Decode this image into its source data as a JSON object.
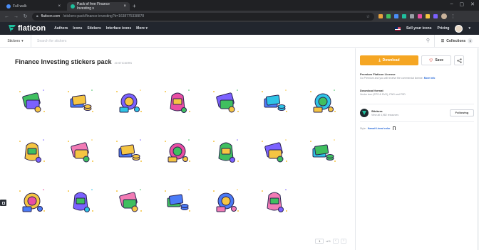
{
  "browser": {
    "tabs": [
      {
        "label": "Full walk",
        "active": false
      },
      {
        "label": "Pack of free Finance Investing s",
        "active": true
      }
    ],
    "new_tab": "+",
    "url_domain": "flaticon.com",
    "url_path": "/stickers-pack/finance-investing?k=1638775338878",
    "window_controls": [
      "–",
      "▢",
      "✕"
    ]
  },
  "site": {
    "logo": "flaticon",
    "nav": [
      "Authors",
      "Icons",
      "Stickers",
      "Interface icons",
      "More ▾"
    ],
    "right": {
      "sell": "Sell your icons",
      "pricing": "Pricing"
    }
  },
  "search": {
    "type_label": "Stickers",
    "placeholder": "Search for stickers",
    "collections_label": "Collections",
    "collections_count": "0"
  },
  "pack": {
    "title": "Finance Investing stickers pack",
    "count": "20 stickers"
  },
  "stickers": [
    {
      "name": "money-wallet-sticker",
      "c1": "#3fbf5f",
      "c2": "#f5c542",
      "c3": "#7b61ff"
    },
    {
      "name": "calculator-coins-sticker",
      "c1": "#4a7bf7",
      "c2": "#f5c542",
      "c3": "#3fbf5f"
    },
    {
      "name": "bank-card-sticker",
      "c1": "#7b61ff",
      "c2": "#2ec4e6",
      "c3": "#f5c542"
    },
    {
      "name": "roulette-coins-sticker",
      "c1": "#e94ea3",
      "c2": "#f5c542",
      "c3": "#3fbf5f"
    },
    {
      "name": "money-bag-sticker",
      "c1": "#7b61ff",
      "c2": "#f5c542",
      "c3": "#3fbf5f"
    },
    {
      "name": "calendar-sticker",
      "c1": "#4a7bf7",
      "c2": "#2ec4e6",
      "c3": "#f5c542"
    },
    {
      "name": "calendar-gold-sticker",
      "c1": "#2ec4e6",
      "c2": "#f5c542",
      "c3": "#3fbf5f"
    },
    {
      "name": "trophy-money-sticker",
      "c1": "#f5c542",
      "c2": "#3fbf5f",
      "c3": "#7b61ff"
    },
    {
      "name": "piggy-bank-sticker",
      "c1": "#f27bb5",
      "c2": "#3fbf5f",
      "c3": "#f5c542"
    },
    {
      "name": "phone-search-sticker",
      "c1": "#4a7bf7",
      "c2": "#f5c542",
      "c3": "#7b61ff"
    },
    {
      "name": "umbrella-money-sticker",
      "c1": "#e94ea3",
      "c2": "#f5c542",
      "c3": "#3fbf5f"
    },
    {
      "name": "money-stack-sticker",
      "c1": "#3fbf5f",
      "c2": "#f5c542",
      "c3": "#7b61ff"
    },
    {
      "name": "wheelbarrow-money-sticker",
      "c1": "#7b61ff",
      "c2": "#3fbf5f",
      "c3": "#f5c542"
    },
    {
      "name": "book-money-sticker",
      "c1": "#2ec4e6",
      "c2": "#3fbf5f",
      "c3": "#f5c542"
    },
    {
      "name": "chart-document-sticker",
      "c1": "#f5c542",
      "c2": "#4a7bf7",
      "c3": "#e94ea3"
    },
    {
      "name": "money-plant-sticker",
      "c1": "#7b61ff",
      "c2": "#3fbf5f",
      "c3": "#2ec4e6"
    },
    {
      "name": "pink-coins-sticker",
      "c1": "#f27bb5",
      "c2": "#f5c542",
      "c3": "#3fbf5f"
    },
    {
      "name": "magnifier-money-sticker",
      "c1": "#3fbf5f",
      "c2": "#4a7bf7",
      "c3": "#f5c542"
    },
    {
      "name": "laptop-growth-sticker",
      "c1": "#4a7bf7",
      "c2": "#f27bb5",
      "c3": "#f5c542"
    },
    {
      "name": "money-sack-sticker",
      "c1": "#f27bb5",
      "c2": "#3fbf5f",
      "c3": "#7b61ff"
    }
  ],
  "pagination": {
    "page": "1",
    "of": "of 1",
    "prev": "‹",
    "next": "›"
  },
  "sidebar": {
    "download_label": "Download",
    "save_label": "Save",
    "share_icon": "share-icon",
    "license_title": "Premium Flaticon License",
    "license_text": "Go Premium and you will receive the commercial license.",
    "license_more": "More info",
    "format_title": "Download format",
    "format_text": "Vector icon (EPS & SVG), PNG and PSD",
    "author_name": "Stickers",
    "author_sub": "View all 4,982 resources",
    "follow_label": "Following",
    "style_label": "Style:",
    "style_value": "Kawaii Lineal color"
  },
  "colors": {
    "accent": "#f5a623",
    "header_bg": "#22262e",
    "brand": "#1fbf9d"
  }
}
